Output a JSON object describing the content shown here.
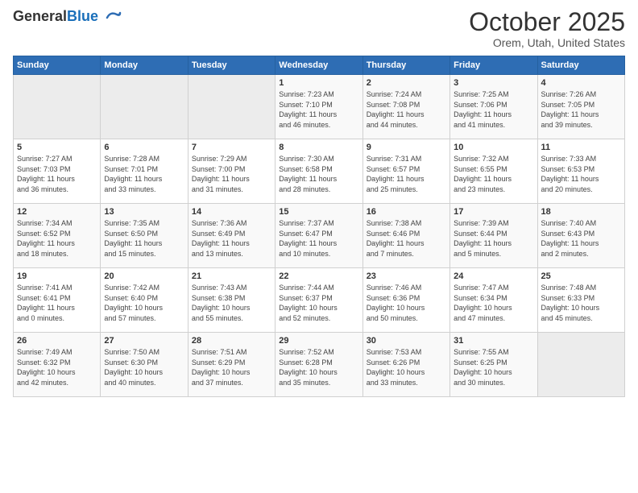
{
  "header": {
    "logo_general": "General",
    "logo_blue": "Blue",
    "month": "October 2025",
    "location": "Orem, Utah, United States"
  },
  "days_of_week": [
    "Sunday",
    "Monday",
    "Tuesday",
    "Wednesday",
    "Thursday",
    "Friday",
    "Saturday"
  ],
  "weeks": [
    [
      {
        "day": "",
        "info": ""
      },
      {
        "day": "",
        "info": ""
      },
      {
        "day": "",
        "info": ""
      },
      {
        "day": "1",
        "info": "Sunrise: 7:23 AM\nSunset: 7:10 PM\nDaylight: 11 hours\nand 46 minutes."
      },
      {
        "day": "2",
        "info": "Sunrise: 7:24 AM\nSunset: 7:08 PM\nDaylight: 11 hours\nand 44 minutes."
      },
      {
        "day": "3",
        "info": "Sunrise: 7:25 AM\nSunset: 7:06 PM\nDaylight: 11 hours\nand 41 minutes."
      },
      {
        "day": "4",
        "info": "Sunrise: 7:26 AM\nSunset: 7:05 PM\nDaylight: 11 hours\nand 39 minutes."
      }
    ],
    [
      {
        "day": "5",
        "info": "Sunrise: 7:27 AM\nSunset: 7:03 PM\nDaylight: 11 hours\nand 36 minutes."
      },
      {
        "day": "6",
        "info": "Sunrise: 7:28 AM\nSunset: 7:01 PM\nDaylight: 11 hours\nand 33 minutes."
      },
      {
        "day": "7",
        "info": "Sunrise: 7:29 AM\nSunset: 7:00 PM\nDaylight: 11 hours\nand 31 minutes."
      },
      {
        "day": "8",
        "info": "Sunrise: 7:30 AM\nSunset: 6:58 PM\nDaylight: 11 hours\nand 28 minutes."
      },
      {
        "day": "9",
        "info": "Sunrise: 7:31 AM\nSunset: 6:57 PM\nDaylight: 11 hours\nand 25 minutes."
      },
      {
        "day": "10",
        "info": "Sunrise: 7:32 AM\nSunset: 6:55 PM\nDaylight: 11 hours\nand 23 minutes."
      },
      {
        "day": "11",
        "info": "Sunrise: 7:33 AM\nSunset: 6:53 PM\nDaylight: 11 hours\nand 20 minutes."
      }
    ],
    [
      {
        "day": "12",
        "info": "Sunrise: 7:34 AM\nSunset: 6:52 PM\nDaylight: 11 hours\nand 18 minutes."
      },
      {
        "day": "13",
        "info": "Sunrise: 7:35 AM\nSunset: 6:50 PM\nDaylight: 11 hours\nand 15 minutes."
      },
      {
        "day": "14",
        "info": "Sunrise: 7:36 AM\nSunset: 6:49 PM\nDaylight: 11 hours\nand 13 minutes."
      },
      {
        "day": "15",
        "info": "Sunrise: 7:37 AM\nSunset: 6:47 PM\nDaylight: 11 hours\nand 10 minutes."
      },
      {
        "day": "16",
        "info": "Sunrise: 7:38 AM\nSunset: 6:46 PM\nDaylight: 11 hours\nand 7 minutes."
      },
      {
        "day": "17",
        "info": "Sunrise: 7:39 AM\nSunset: 6:44 PM\nDaylight: 11 hours\nand 5 minutes."
      },
      {
        "day": "18",
        "info": "Sunrise: 7:40 AM\nSunset: 6:43 PM\nDaylight: 11 hours\nand 2 minutes."
      }
    ],
    [
      {
        "day": "19",
        "info": "Sunrise: 7:41 AM\nSunset: 6:41 PM\nDaylight: 11 hours\nand 0 minutes."
      },
      {
        "day": "20",
        "info": "Sunrise: 7:42 AM\nSunset: 6:40 PM\nDaylight: 10 hours\nand 57 minutes."
      },
      {
        "day": "21",
        "info": "Sunrise: 7:43 AM\nSunset: 6:38 PM\nDaylight: 10 hours\nand 55 minutes."
      },
      {
        "day": "22",
        "info": "Sunrise: 7:44 AM\nSunset: 6:37 PM\nDaylight: 10 hours\nand 52 minutes."
      },
      {
        "day": "23",
        "info": "Sunrise: 7:46 AM\nSunset: 6:36 PM\nDaylight: 10 hours\nand 50 minutes."
      },
      {
        "day": "24",
        "info": "Sunrise: 7:47 AM\nSunset: 6:34 PM\nDaylight: 10 hours\nand 47 minutes."
      },
      {
        "day": "25",
        "info": "Sunrise: 7:48 AM\nSunset: 6:33 PM\nDaylight: 10 hours\nand 45 minutes."
      }
    ],
    [
      {
        "day": "26",
        "info": "Sunrise: 7:49 AM\nSunset: 6:32 PM\nDaylight: 10 hours\nand 42 minutes."
      },
      {
        "day": "27",
        "info": "Sunrise: 7:50 AM\nSunset: 6:30 PM\nDaylight: 10 hours\nand 40 minutes."
      },
      {
        "day": "28",
        "info": "Sunrise: 7:51 AM\nSunset: 6:29 PM\nDaylight: 10 hours\nand 37 minutes."
      },
      {
        "day": "29",
        "info": "Sunrise: 7:52 AM\nSunset: 6:28 PM\nDaylight: 10 hours\nand 35 minutes."
      },
      {
        "day": "30",
        "info": "Sunrise: 7:53 AM\nSunset: 6:26 PM\nDaylight: 10 hours\nand 33 minutes."
      },
      {
        "day": "31",
        "info": "Sunrise: 7:55 AM\nSunset: 6:25 PM\nDaylight: 10 hours\nand 30 minutes."
      },
      {
        "day": "",
        "info": ""
      }
    ]
  ]
}
